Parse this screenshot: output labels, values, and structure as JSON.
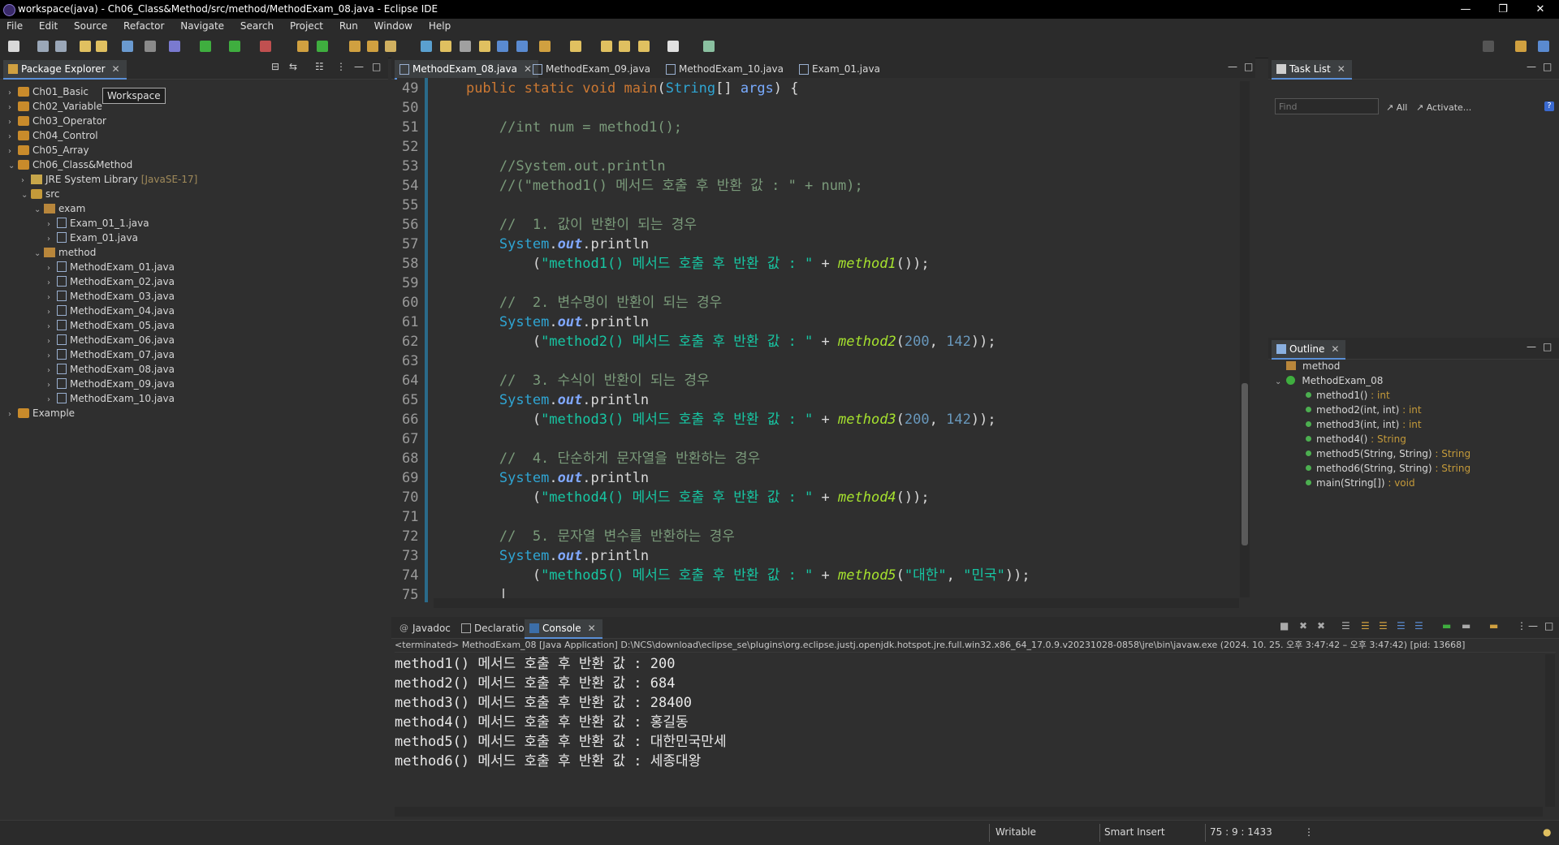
{
  "window": {
    "title": "workspace(java) - Ch06_Class&Method/src/method/MethodExam_08.java - Eclipse IDE"
  },
  "menu": [
    "File",
    "Edit",
    "Source",
    "Refactor",
    "Navigate",
    "Search",
    "Project",
    "Run",
    "Window",
    "Help"
  ],
  "package_explorer": {
    "tab_label": "Package Explorer",
    "tooltip": "Workspace",
    "items": [
      {
        "label": "Ch01_Basic",
        "depth": 0,
        "kind": "project",
        "arrow": "›"
      },
      {
        "label": "Ch02_Variable",
        "depth": 0,
        "kind": "project",
        "arrow": "›"
      },
      {
        "label": "Ch03_Operator",
        "depth": 0,
        "kind": "project",
        "arrow": "›"
      },
      {
        "label": "Ch04_Control",
        "depth": 0,
        "kind": "project",
        "arrow": "›"
      },
      {
        "label": "Ch05_Array",
        "depth": 0,
        "kind": "project",
        "arrow": "›"
      },
      {
        "label": "Ch06_Class&Method",
        "depth": 0,
        "kind": "project",
        "arrow": "⌄"
      },
      {
        "label": "JRE System Library",
        "suffix": "[JavaSE-17]",
        "depth": 1,
        "kind": "jre",
        "arrow": "›"
      },
      {
        "label": "src",
        "depth": 1,
        "kind": "src",
        "arrow": "⌄"
      },
      {
        "label": "exam",
        "depth": 2,
        "kind": "pkg",
        "arrow": "⌄"
      },
      {
        "label": "Exam_01_1.java",
        "depth": 3,
        "kind": "file",
        "arrow": "›"
      },
      {
        "label": "Exam_01.java",
        "depth": 3,
        "kind": "file",
        "arrow": "›"
      },
      {
        "label": "method",
        "depth": 2,
        "kind": "pkg",
        "arrow": "⌄"
      },
      {
        "label": "MethodExam_01.java",
        "depth": 3,
        "kind": "file",
        "arrow": "›"
      },
      {
        "label": "MethodExam_02.java",
        "depth": 3,
        "kind": "file",
        "arrow": "›"
      },
      {
        "label": "MethodExam_03.java",
        "depth": 3,
        "kind": "file",
        "arrow": "›"
      },
      {
        "label": "MethodExam_04.java",
        "depth": 3,
        "kind": "file",
        "arrow": "›"
      },
      {
        "label": "MethodExam_05.java",
        "depth": 3,
        "kind": "file",
        "arrow": "›"
      },
      {
        "label": "MethodExam_06.java",
        "depth": 3,
        "kind": "file",
        "arrow": "›"
      },
      {
        "label": "MethodExam_07.java",
        "depth": 3,
        "kind": "file",
        "arrow": "›"
      },
      {
        "label": "MethodExam_08.java",
        "depth": 3,
        "kind": "file",
        "arrow": "›"
      },
      {
        "label": "MethodExam_09.java",
        "depth": 3,
        "kind": "file",
        "arrow": "›"
      },
      {
        "label": "MethodExam_10.java",
        "depth": 3,
        "kind": "file",
        "arrow": "›"
      },
      {
        "label": "Example",
        "depth": 0,
        "kind": "project",
        "arrow": "›"
      }
    ]
  },
  "editor": {
    "tabs": [
      "MethodExam_08.java",
      "MethodExam_09.java",
      "MethodExam_10.java",
      "Exam_01.java"
    ],
    "active_tab": 0,
    "lines": [
      {
        "n": "49",
        "tokens": [
          [
            "plain",
            "    "
          ],
          [
            "kw",
            "public"
          ],
          [
            "plain",
            " "
          ],
          [
            "kw",
            "static"
          ],
          [
            "plain",
            " "
          ],
          [
            "kw",
            "void"
          ],
          [
            "plain",
            " "
          ],
          [
            "kw",
            "main"
          ],
          [
            "plain",
            "("
          ],
          [
            "type",
            "String"
          ],
          [
            "plain",
            "[] "
          ],
          [
            "param",
            "args"
          ],
          [
            "plain",
            ") {"
          ]
        ]
      },
      {
        "n": "50",
        "tokens": []
      },
      {
        "n": "51",
        "tokens": [
          [
            "cm",
            "        //int num = method1();"
          ]
        ]
      },
      {
        "n": "52",
        "tokens": []
      },
      {
        "n": "53",
        "tokens": [
          [
            "cm",
            "        //System.out.println"
          ]
        ]
      },
      {
        "n": "54",
        "tokens": [
          [
            "cm",
            "        //(\"method1() 메서드 호출 후 반환 값 : \" + num);"
          ]
        ]
      },
      {
        "n": "55",
        "tokens": []
      },
      {
        "n": "56",
        "tokens": [
          [
            "cm",
            "        //  1. 값이 반환이 되는 경우"
          ]
        ]
      },
      {
        "n": "57",
        "tokens": [
          [
            "plain",
            "        "
          ],
          [
            "type",
            "System"
          ],
          [
            "plain",
            "."
          ],
          [
            "field",
            "out"
          ],
          [
            "plain",
            ".println"
          ]
        ]
      },
      {
        "n": "58",
        "tokens": [
          [
            "plain",
            "            ("
          ],
          [
            "str",
            "\"method1() 메서드 호출 후 반환 값 : \""
          ],
          [
            "plain",
            " + "
          ],
          [
            "meth",
            "method1"
          ],
          [
            "plain",
            "());"
          ]
        ]
      },
      {
        "n": "59",
        "tokens": []
      },
      {
        "n": "60",
        "tokens": [
          [
            "cm",
            "        //  2. 변수명이 반환이 되는 경우"
          ]
        ]
      },
      {
        "n": "61",
        "tokens": [
          [
            "plain",
            "        "
          ],
          [
            "type",
            "System"
          ],
          [
            "plain",
            "."
          ],
          [
            "field",
            "out"
          ],
          [
            "plain",
            ".println"
          ]
        ]
      },
      {
        "n": "62",
        "tokens": [
          [
            "plain",
            "            ("
          ],
          [
            "str",
            "\"method2() 메서드 호출 후 반환 값 : \""
          ],
          [
            "plain",
            " + "
          ],
          [
            "meth",
            "method2"
          ],
          [
            "plain",
            "("
          ],
          [
            "num",
            "200"
          ],
          [
            "plain",
            ", "
          ],
          [
            "num",
            "142"
          ],
          [
            "plain",
            "));"
          ]
        ]
      },
      {
        "n": "63",
        "tokens": []
      },
      {
        "n": "64",
        "tokens": [
          [
            "cm",
            "        //  3. 수식이 반환이 되는 경우"
          ]
        ]
      },
      {
        "n": "65",
        "tokens": [
          [
            "plain",
            "        "
          ],
          [
            "type",
            "System"
          ],
          [
            "plain",
            "."
          ],
          [
            "field",
            "out"
          ],
          [
            "plain",
            ".println"
          ]
        ]
      },
      {
        "n": "66",
        "tokens": [
          [
            "plain",
            "            ("
          ],
          [
            "str",
            "\"method3() 메서드 호출 후 반환 값 : \""
          ],
          [
            "plain",
            " + "
          ],
          [
            "meth",
            "method3"
          ],
          [
            "plain",
            "("
          ],
          [
            "num",
            "200"
          ],
          [
            "plain",
            ", "
          ],
          [
            "num",
            "142"
          ],
          [
            "plain",
            "));"
          ]
        ]
      },
      {
        "n": "67",
        "tokens": []
      },
      {
        "n": "68",
        "tokens": [
          [
            "cm",
            "        //  4. 단순하게 문자열을 반환하는 경우"
          ]
        ]
      },
      {
        "n": "69",
        "tokens": [
          [
            "plain",
            "        "
          ],
          [
            "type",
            "System"
          ],
          [
            "plain",
            "."
          ],
          [
            "field",
            "out"
          ],
          [
            "plain",
            ".println"
          ]
        ]
      },
      {
        "n": "70",
        "tokens": [
          [
            "plain",
            "            ("
          ],
          [
            "str",
            "\"method4() 메서드 호출 후 반환 값 : \""
          ],
          [
            "plain",
            " + "
          ],
          [
            "meth",
            "method4"
          ],
          [
            "plain",
            "());"
          ]
        ]
      },
      {
        "n": "71",
        "tokens": []
      },
      {
        "n": "72",
        "tokens": [
          [
            "cm",
            "        //  5. 문자열 변수를 반환하는 경우"
          ]
        ]
      },
      {
        "n": "73",
        "tokens": [
          [
            "plain",
            "        "
          ],
          [
            "type",
            "System"
          ],
          [
            "plain",
            "."
          ],
          [
            "field",
            "out"
          ],
          [
            "plain",
            ".println"
          ]
        ]
      },
      {
        "n": "74",
        "tokens": [
          [
            "plain",
            "            ("
          ],
          [
            "str",
            "\"method5() 메서드 호출 후 반환 값 : \""
          ],
          [
            "plain",
            " + "
          ],
          [
            "meth",
            "method5"
          ],
          [
            "plain",
            "("
          ],
          [
            "str",
            "\"대한\""
          ],
          [
            "plain",
            ", "
          ],
          [
            "str",
            "\"민국\""
          ],
          [
            "plain",
            "));"
          ]
        ]
      },
      {
        "n": "75",
        "tokens": [
          [
            "plain",
            "        |"
          ]
        ]
      }
    ]
  },
  "task_list": {
    "tab_label": "Task List",
    "find_placeholder": "Find",
    "all_label": "All",
    "activate_label": "Activate..."
  },
  "outline": {
    "tab_label": "Outline",
    "package": "method",
    "class": "MethodExam_08",
    "members": [
      {
        "name": "method1()",
        "type": " : int"
      },
      {
        "name": "method2(int, int)",
        "type": " : int"
      },
      {
        "name": "method3(int, int)",
        "type": " : int"
      },
      {
        "name": "method4()",
        "type": " : String"
      },
      {
        "name": "method5(String, String)",
        "type": " : String"
      },
      {
        "name": "method6(String, String)",
        "type": " : String"
      },
      {
        "name": "main(String[])",
        "type": " : void"
      }
    ]
  },
  "bottom_panel": {
    "tabs": [
      "Javadoc",
      "Declaration",
      "Console"
    ],
    "active_tab": 2,
    "terminated": "<terminated> MethodExam_08 [Java Application] D:\\NCS\\download\\eclipse_se\\plugins\\org.eclipse.justj.openjdk.hotspot.jre.full.win32.x86_64_17.0.9.v20231028-0858\\jre\\bin\\javaw.exe  (2024. 10. 25. 오후 3:47:42 – 오후 3:47:42) [pid: 13668]",
    "output": [
      "method1() 메서드 호출 후 반환 값 : 200",
      "method2() 메서드 호출 후 반환 값 : 684",
      "method3() 메서드 호출 후 반환 값 : 28400",
      "method4() 메서드 호출 후 반환 값 : 홍길동",
      "method5() 메서드 호출 후 반환 값 : 대한민국만세",
      "method6() 메서드 호출 후 반환 값 : 세종대왕"
    ]
  },
  "status": {
    "writable": "Writable",
    "insert_mode": "Smart Insert",
    "position": "75 : 9 : 1433"
  }
}
